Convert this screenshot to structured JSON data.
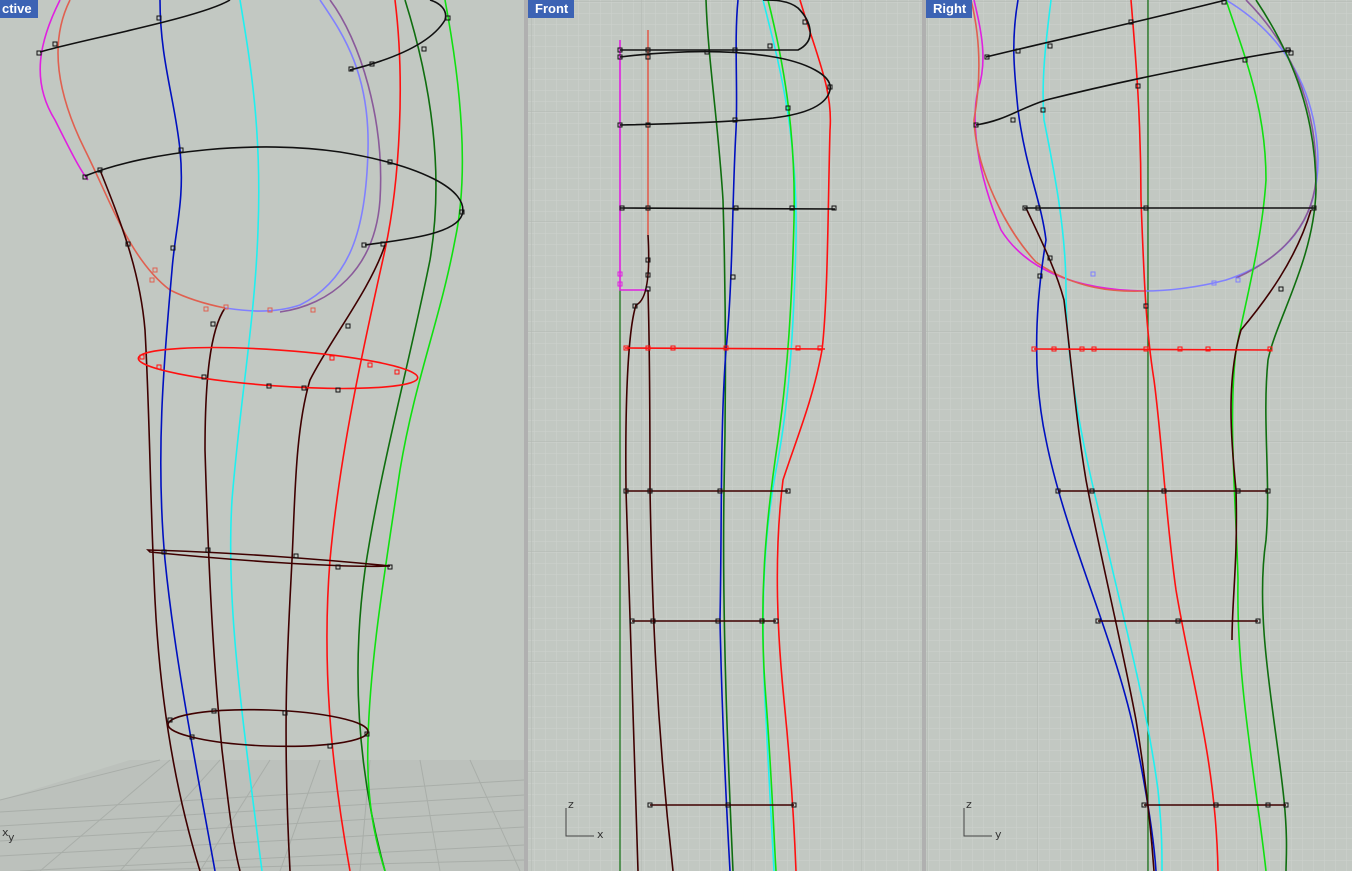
{
  "viewports": {
    "perspective": {
      "title": "ctive",
      "axis_x": "x",
      "axis_y": "y"
    },
    "front": {
      "title": "Front",
      "axis_v": "z",
      "axis_h": "x"
    },
    "right": {
      "title": "Right",
      "axis_v": "z",
      "axis_h": "y"
    }
  },
  "colors": {
    "viewport_bg": "#c2c8c2",
    "grid_minor": "#cfd4cf",
    "grid_major": "#b3b8b3",
    "title_bg": "#3c63b4",
    "curve_black": "#111111",
    "curve_red": "#ff1010",
    "curve_darkred": "#3f0000",
    "curve_blue": "#0010c0",
    "curve_cyan": "#20f0f0",
    "curve_green": "#10e010",
    "curve_darkgreen": "#0f6e0f",
    "curve_magenta": "#e020e0",
    "curve_violet": "#8080ff",
    "curve_salmon": "#e06050"
  }
}
